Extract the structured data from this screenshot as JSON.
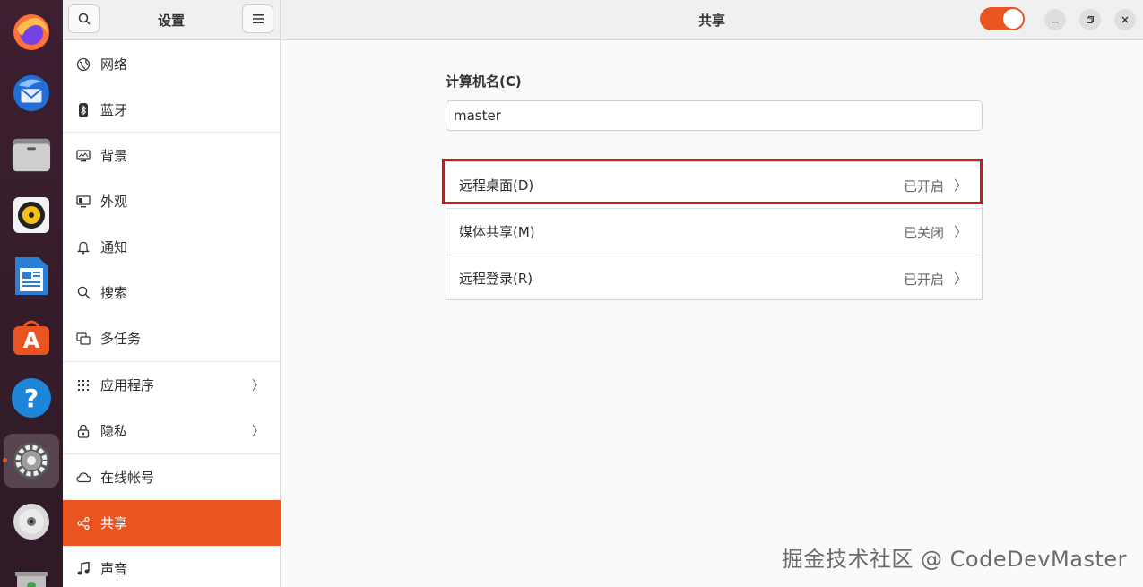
{
  "dock": {
    "apps": [
      {
        "name": "firefox",
        "active": false
      },
      {
        "name": "thunderbird",
        "active": false
      },
      {
        "name": "files",
        "active": false
      },
      {
        "name": "rhythmbox",
        "active": false
      },
      {
        "name": "libreoffice-writer",
        "active": false
      },
      {
        "name": "app-center",
        "active": false
      },
      {
        "name": "help",
        "active": false
      },
      {
        "name": "settings",
        "active": true
      },
      {
        "name": "optical-disc",
        "active": false
      },
      {
        "name": "trash",
        "active": false
      }
    ],
    "help_glyph": "?",
    "store_glyph": "A"
  },
  "sidebar": {
    "title": "设置",
    "items": [
      {
        "label": "网络",
        "icon": "globe-icon"
      },
      {
        "label": "蓝牙",
        "icon": "bluetooth-icon"
      },
      {
        "label": "背景",
        "icon": "display-icon"
      },
      {
        "label": "外观",
        "icon": "appearance-icon"
      },
      {
        "label": "通知",
        "icon": "bell-icon"
      },
      {
        "label": "搜索",
        "icon": "search-icon"
      },
      {
        "label": "多任务",
        "icon": "multitask-icon"
      },
      {
        "label": "应用程序",
        "icon": "apps-grid-icon"
      },
      {
        "label": "隐私",
        "icon": "lock-icon"
      },
      {
        "label": "在线帐号",
        "icon": "cloud-icon"
      },
      {
        "label": "共享",
        "icon": "share-icon"
      },
      {
        "label": "声音",
        "icon": "music-note-icon"
      }
    ],
    "selected": "共享"
  },
  "header": {
    "title": "共享",
    "sharing_enabled": true
  },
  "main": {
    "computer_name_label": "计算机名(C)",
    "computer_name_value": "master",
    "rows": [
      {
        "label": "远程桌面(D)",
        "status": "已开启"
      },
      {
        "label": "媒体共享(M)",
        "status": "已关闭"
      },
      {
        "label": "远程登录(R)",
        "status": "已开启"
      }
    ],
    "chevron": "〉"
  },
  "watermark": "掘金技术社区 @ CodeDevMaster",
  "colors": {
    "accent": "#e95420",
    "highlight_box": "#d7141a"
  }
}
